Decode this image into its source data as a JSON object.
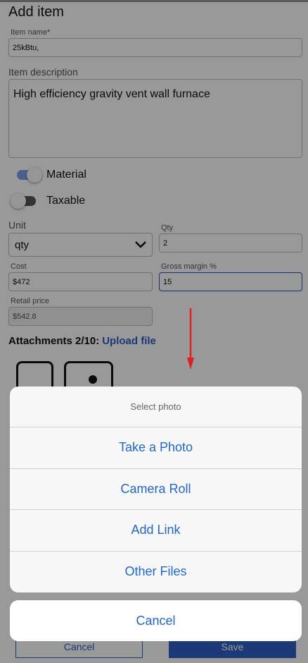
{
  "form": {
    "title": "Add item",
    "item_name_label": "Item name*",
    "item_name_value": "25kBtu,",
    "description_label": "Item description",
    "description_value": "High efficiency gravity vent wall furnace",
    "material_label": "Material",
    "material_on": true,
    "taxable_label": "Taxable",
    "taxable_on": false,
    "unit_label": "Unit",
    "unit_value": "qty",
    "qty_label": "Qty",
    "qty_value": "2",
    "cost_label": "Cost",
    "cost_value": "$472",
    "margin_label": "Gross margin %",
    "margin_value": "15",
    "retail_label": "Retail price",
    "retail_value": "$542.8",
    "attachments_label": "Attachments 2/10:",
    "upload_label": "Upload file",
    "cancel_label": "Cancel",
    "save_label": "Save"
  },
  "sheet": {
    "header": "Select photo",
    "options": [
      "Take a Photo",
      "Camera Roll",
      "Add Link",
      "Other Files"
    ],
    "cancel": "Cancel"
  },
  "colors": {
    "accent": "#2d5fc6",
    "sheet_text": "#2368c4",
    "arrow": "#e02020"
  },
  "icons": {
    "unit_dropdown": "chevron-down-icon",
    "attachment_1": "file-icon",
    "attachment_2": "image-icon",
    "annotation": "red-arrow-icon"
  }
}
